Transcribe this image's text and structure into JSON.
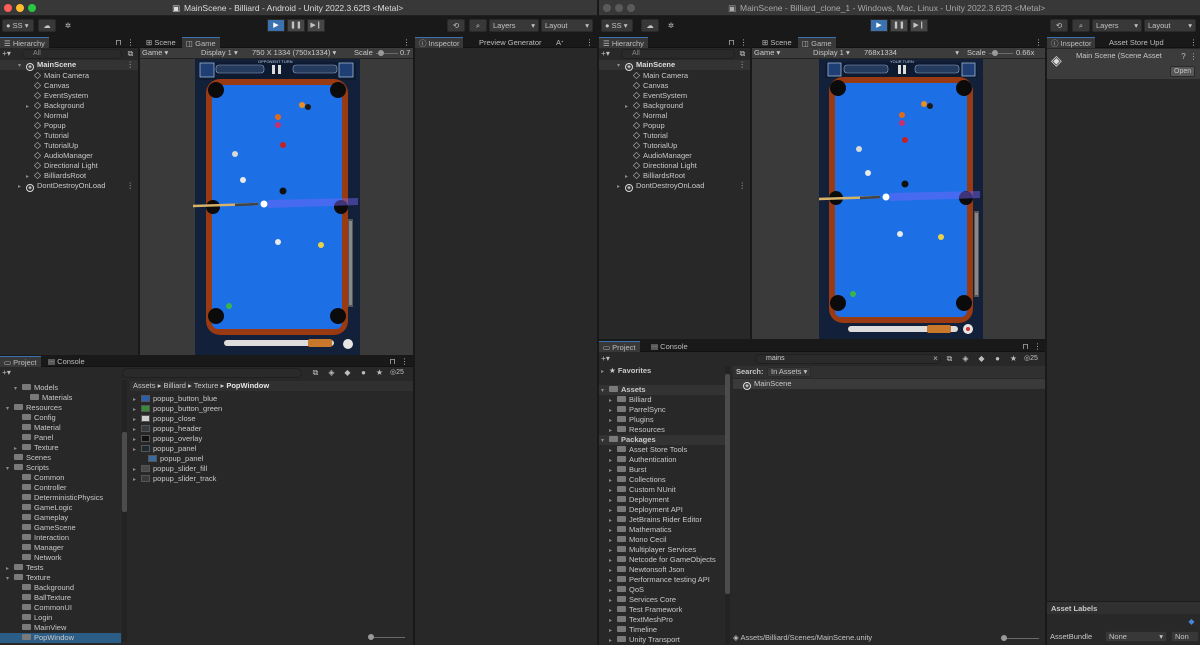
{
  "left": {
    "title": "MainScene - Billiard - Android - Unity 2022.3.62f3 <Metal>",
    "account": "SS",
    "layers": "Layers",
    "layout": "Layout",
    "hierarchy": {
      "tab": "Hierarchy",
      "search_placeholder": "All",
      "scene": "MainScene",
      "items": [
        "Main Camera",
        "Canvas",
        "EventSystem",
        "Background",
        "Normal",
        "Popup",
        "Tutorial",
        "TutorialUp",
        "AudioManager",
        "Directional Light",
        "BilliardsRoot"
      ],
      "dont_destroy": "DontDestroyOnLoad"
    },
    "scene_tab": "Scene",
    "game_tab": "Game",
    "game_dropdown": "Game",
    "display": "Display 1",
    "resolution": "750 X 1334 (750x1334)",
    "scale_label": "Scale",
    "scale_value": "0.7",
    "inspector_tab": "Inspector",
    "preview_tab": "Preview Generator",
    "ai_tab": "A",
    "project_tab": "Project",
    "console_tab": "Console",
    "hidden_count": "25",
    "tree": [
      {
        "label": "Models",
        "indent": 2,
        "arrow": "▾",
        "open": true
      },
      {
        "label": "Materials",
        "indent": 3,
        "arrow": "",
        "open": false
      },
      {
        "label": "Resources",
        "indent": 1,
        "arrow": "▾",
        "open": true
      },
      {
        "label": "Config",
        "indent": 2,
        "arrow": "",
        "open": false
      },
      {
        "label": "Material",
        "indent": 2,
        "arrow": "",
        "open": false
      },
      {
        "label": "Panel",
        "indent": 2,
        "arrow": "",
        "open": false
      },
      {
        "label": "Texture",
        "indent": 2,
        "arrow": "▸",
        "open": false
      },
      {
        "label": "Scenes",
        "indent": 1,
        "arrow": "",
        "open": false
      },
      {
        "label": "Scripts",
        "indent": 1,
        "arrow": "▾",
        "open": true
      },
      {
        "label": "Common",
        "indent": 2,
        "arrow": "",
        "open": false
      },
      {
        "label": "Controller",
        "indent": 2,
        "arrow": "",
        "open": false
      },
      {
        "label": "DeterministicPhysics",
        "indent": 2,
        "arrow": "",
        "open": false
      },
      {
        "label": "GameLogic",
        "indent": 2,
        "arrow": "",
        "open": false
      },
      {
        "label": "Gameplay",
        "indent": 2,
        "arrow": "",
        "open": false
      },
      {
        "label": "GameScene",
        "indent": 2,
        "arrow": "",
        "open": false
      },
      {
        "label": "Interaction",
        "indent": 2,
        "arrow": "",
        "open": false
      },
      {
        "label": "Manager",
        "indent": 2,
        "arrow": "",
        "open": false
      },
      {
        "label": "Network",
        "indent": 2,
        "arrow": "",
        "open": false
      },
      {
        "label": "Tests",
        "indent": 1,
        "arrow": "▸",
        "open": false
      },
      {
        "label": "Texture",
        "indent": 1,
        "arrow": "▾",
        "open": true
      },
      {
        "label": "Background",
        "indent": 2,
        "arrow": "",
        "open": false
      },
      {
        "label": "BallTexture",
        "indent": 2,
        "arrow": "",
        "open": false
      },
      {
        "label": "CommonUI",
        "indent": 2,
        "arrow": "",
        "open": false
      },
      {
        "label": "Login",
        "indent": 2,
        "arrow": "",
        "open": false
      },
      {
        "label": "MainView",
        "indent": 2,
        "arrow": "",
        "open": false
      },
      {
        "label": "PopWindow",
        "indent": 2,
        "arrow": "",
        "open": false,
        "selected": true
      }
    ],
    "breadcrumb": [
      "Assets",
      "Billiard",
      "Texture",
      "PopWindow"
    ],
    "files": [
      {
        "label": "popup_button_blue",
        "sw": "#2b5db0",
        "child": false
      },
      {
        "label": "popup_button_green",
        "sw": "#3a8a3a",
        "child": false
      },
      {
        "label": "popup_close",
        "sw": "#cfcfcf",
        "child": false
      },
      {
        "label": "popup_header",
        "sw": "#333a40",
        "child": false
      },
      {
        "label": "popup_overlay",
        "sw": "#111111",
        "child": false
      },
      {
        "label": "popup_panel",
        "sw": "#1c2a33",
        "child": false
      },
      {
        "label": "popup_panel",
        "sw": "#3a6aa0",
        "child": true
      },
      {
        "label": "popup_slider_fill",
        "sw": "#4a4a4a",
        "child": false
      },
      {
        "label": "popup_slider_track",
        "sw": "#3a3a3a",
        "child": false
      }
    ]
  },
  "right": {
    "title": "MainScene - Billiard_clone_1 - Windows, Mac, Linux - Unity 2022.3.62f3 <Metal>",
    "account": "SS",
    "layers": "Layers",
    "layout": "Layout",
    "hierarchy": {
      "tab": "Hierarchy",
      "search_placeholder": "All",
      "scene": "MainScene",
      "items": [
        "Main Camera",
        "Canvas",
        "EventSystem",
        "Background",
        "Normal",
        "Popup",
        "Tutorial",
        "TutorialUp",
        "AudioManager",
        "Directional Light",
        "BilliardsRoot"
      ],
      "dont_destroy": "DontDestroyOnLoad"
    },
    "scene_tab": "Scene",
    "game_tab": "Game",
    "game_dropdown": "Game",
    "display": "Display 1",
    "resolution": "768x1334",
    "scale_label": "Scale",
    "scale_value": "0.66x",
    "inspector_tab": "Inspector",
    "asset_store_tab": "Asset Store Upd",
    "inspector_title": "Main Scene (Scene Asset",
    "open_button": "Open",
    "project_tab": "Project",
    "console_tab": "Console",
    "search_value": "mains",
    "hidden_count": "25",
    "favorites": "Favorites",
    "assets_label": "Assets",
    "assets_children": [
      "Billiard",
      "ParrelSync",
      "Plugins",
      "Resources"
    ],
    "packages_label": "Packages",
    "packages": [
      "Asset Store Tools",
      "Authentication",
      "Burst",
      "Collections",
      "Custom NUnit",
      "Deployment",
      "Deployment API",
      "JetBrains Rider Editor",
      "Mathematics",
      "Mono Cecil",
      "Multiplayer Services",
      "Netcode for GameObjects",
      "Newtonsoft Json",
      "Performance testing API",
      "QoS",
      "Services Core",
      "Test Framework",
      "TextMeshPro",
      "Timeline",
      "Unity Transport"
    ],
    "search_label": "Search:",
    "search_scope": "In Assets",
    "result": "MainScene",
    "footer_path": "Assets/Billiard/Scenes/MainScene.unity",
    "asset_labels": "Asset Labels",
    "assetbundle_label": "AssetBundle",
    "assetbundle_value": "None",
    "assetbundle_variant": "Non"
  },
  "game_left": {
    "turn_label": "OPPONENT TURN"
  },
  "game_right": {
    "turn_label": "YOUR TURN"
  },
  "colors": {
    "felt": "#1d6fe6",
    "rail": "#9a3a12",
    "accent": "#3a72b0"
  }
}
